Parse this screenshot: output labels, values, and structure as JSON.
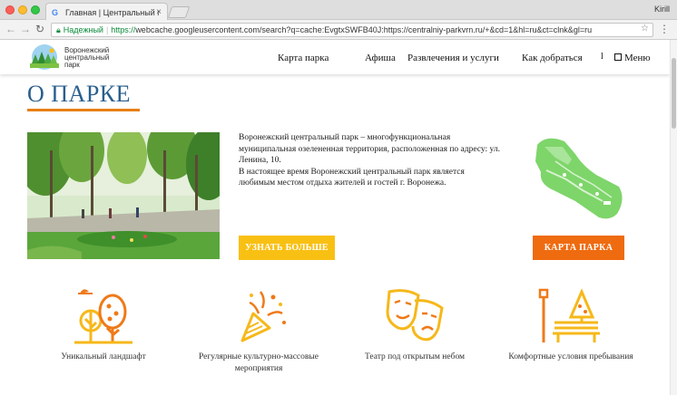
{
  "browser": {
    "tab_title": "Главная | Центральный парк",
    "tab_close": "×",
    "profile": "Kirill",
    "secure_label": "Надежный",
    "url_scheme": "https://",
    "url_rest": "webcache.googleusercontent.com/search?q=cache:EvgtxSWFB40J:https://centralniy-parkvrn.ru/+&cd=1&hl=ru&ct=clnk&gl=ru"
  },
  "header": {
    "logo_text": "Воронежский центральный парк",
    "nav": [
      "Карта парка",
      "Афиша",
      "Развлечения и услуги",
      "Как добраться"
    ],
    "search_glyph": "l",
    "menu_label": "Меню"
  },
  "about": {
    "title": "О ПАРКЕ",
    "paragraph1": "Воронежский центральный парк – многофункциональная муниципальная озелененная территория, расположенная по адресу: ул. Ленина, 10.",
    "paragraph2": "В настоящее время Воронежский центральный парк является любимым местом отдыха жителей и гостей г. Воронежа.",
    "more_button": "УЗНАТЬ БОЛЬШЕ",
    "map_button": "КАРТА ПАРКА"
  },
  "features": [
    {
      "label": "Уникальный ландшафт",
      "icon": "trees-icon"
    },
    {
      "label": "Регулярные культурно-массовые мероприятия",
      "icon": "party-popper-icon"
    },
    {
      "label": "Театр под открытым небом",
      "icon": "theater-masks-icon"
    },
    {
      "label": "Комфортные условия пребывания",
      "icon": "park-bench-icon"
    }
  ],
  "colors": {
    "title": "#2a5f8e",
    "underline": "#e77f14",
    "more_button": "#f9c014",
    "map_button": "#ef6b10",
    "icon_yellow": "#f6b81a",
    "icon_orange": "#ef7a18"
  }
}
